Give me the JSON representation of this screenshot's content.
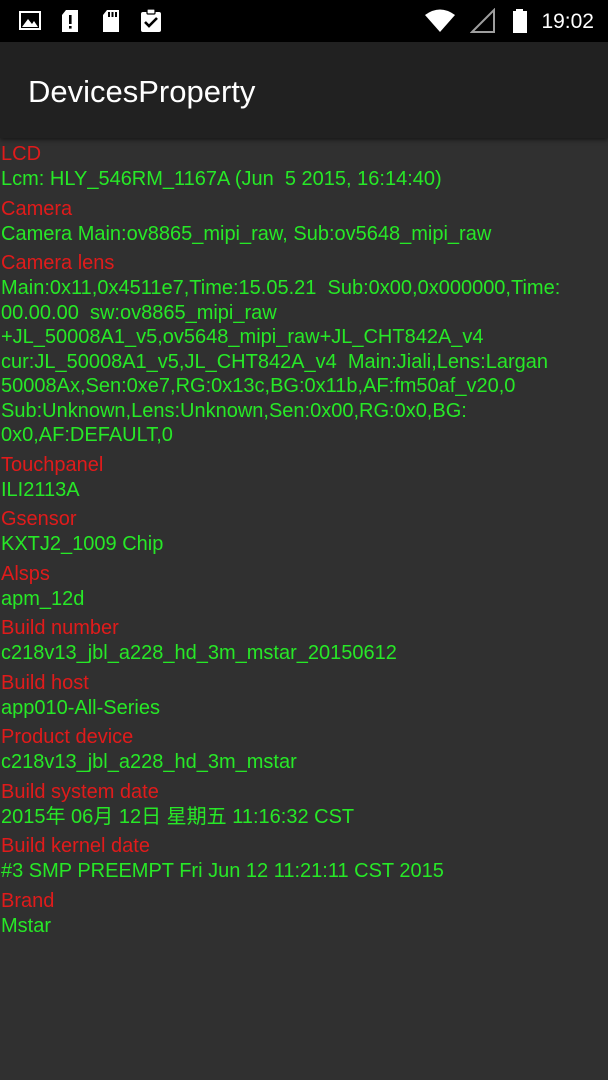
{
  "status_bar": {
    "time": "19:02",
    "icons": [
      "image-icon",
      "sd-card-alert-icon",
      "sd-card-icon",
      "clipboard-check-icon",
      "wifi-icon",
      "signal-icon",
      "battery-icon"
    ]
  },
  "app_bar": {
    "title": "DevicesProperty"
  },
  "properties": [
    {
      "label": "LCD",
      "value": "Lcm: HLY_546RM_1167A (Jun  5 2015, 16:14:40)"
    },
    {
      "label": "Camera",
      "value": "Camera Main:ov8865_mipi_raw, Sub:ov5648_mipi_raw"
    },
    {
      "label": "Camera lens",
      "value": "Main:0x11,0x4511e7,Time:15.05.21  Sub:0x00,0x000000,Time:\n00.00.00  sw:ov8865_mipi_raw\n+JL_50008A1_v5,ov5648_mipi_raw+JL_CHT842A_v4\ncur:JL_50008A1_v5,JL_CHT842A_v4  Main:Jiali,Lens:Largan\n50008Ax,Sen:0xe7,RG:0x13c,BG:0x11b,AF:fm50af_v20,0\nSub:Unknown,Lens:Unknown,Sen:0x00,RG:0x0,BG:\n0x0,AF:DEFAULT,0"
    },
    {
      "label": "Touchpanel",
      "value": "ILI2113A"
    },
    {
      "label": "Gsensor",
      "value": "KXTJ2_1009 Chip"
    },
    {
      "label": "Alsps",
      "value": "apm_12d"
    },
    {
      "label": "Build number",
      "value": "c218v13_jbl_a228_hd_3m_mstar_20150612"
    },
    {
      "label": "Build host",
      "value": "app010-All-Series"
    },
    {
      "label": "Product device",
      "value": "c218v13_jbl_a228_hd_3m_mstar"
    },
    {
      "label": "Build system date",
      "value": "2015年 06月 12日 星期五 11:16:32 CST"
    },
    {
      "label": "Build kernel date",
      "value": "#3 SMP PREEMPT Fri Jun 12 11:21:11 CST 2015"
    },
    {
      "label": "Brand",
      "value": "Mstar"
    }
  ],
  "colors": {
    "label": "#e01b1b",
    "value": "#27e827",
    "background": "#303030",
    "app_bar": "#212121"
  }
}
